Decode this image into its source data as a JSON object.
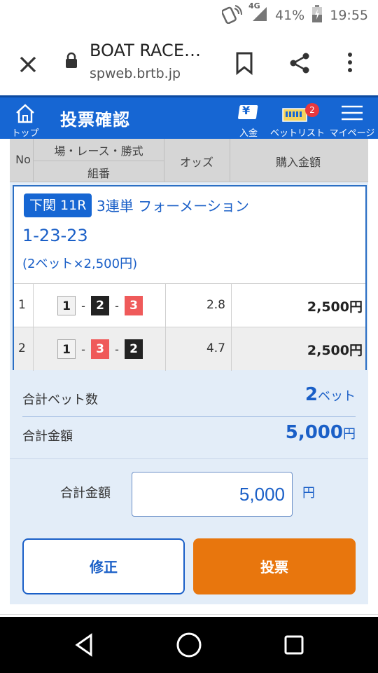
{
  "status_bar": {
    "network": "4G",
    "battery": "41%",
    "time": "19:55"
  },
  "browser": {
    "title": "BOAT RACE…",
    "url": "spweb.brtb.jp"
  },
  "app_header": {
    "home_label": "トップ",
    "page_title": "投票確認",
    "deposit_label": "入金",
    "deposit_icon_glyph": "¥",
    "betlist_label": "ベットリスト",
    "betlist_badge": "2",
    "mypage_label": "マイページ"
  },
  "table_header": {
    "no": "No",
    "race": "場・レース・勝式",
    "combo": "組番",
    "odds": "オッズ",
    "amount": "購入金額"
  },
  "bet": {
    "venue_race": "下関 11R",
    "type": "3連単 フォーメーション",
    "combination": "1-23-23",
    "detail": "(2ベット×2,500円)",
    "rows": [
      {
        "no": "1",
        "boats": [
          "1",
          "2",
          "3"
        ],
        "odds": "2.8",
        "amount": "2,500円"
      },
      {
        "no": "2",
        "boats": [
          "1",
          "3",
          "2"
        ],
        "odds": "4.7",
        "amount": "2,500円"
      }
    ]
  },
  "totals": {
    "bets_label": "合計ベット数",
    "bets_value": "2",
    "bets_unit": "ベット",
    "amount_label": "合計金額",
    "amount_value": "5,000",
    "amount_unit": "円"
  },
  "input": {
    "label": "合計金額",
    "value": "5,000",
    "unit": "円"
  },
  "buttons": {
    "edit": "修正",
    "vote": "投票"
  },
  "colors": {
    "header_blue": "#1666d3",
    "accent_blue": "#1a5fc7",
    "vote_orange": "#e8760d",
    "boat1": "#f2f2f2",
    "boat2": "#222222",
    "boat3": "#ef5a5a"
  }
}
